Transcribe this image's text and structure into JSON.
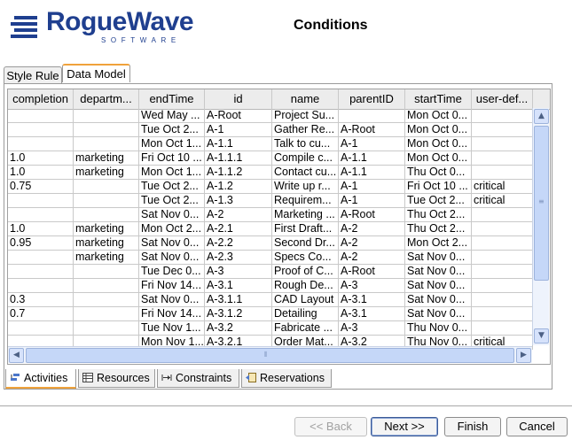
{
  "header": {
    "logo_text": "RogueWave",
    "logo_sub": "SOFTWARE",
    "title": "Conditions"
  },
  "top_tabs": [
    {
      "label": "Style Rule"
    },
    {
      "label": "Data Model"
    }
  ],
  "table": {
    "columns": [
      "completion",
      "departm...",
      "endTime",
      "id",
      "name",
      "parentID",
      "startTime",
      "user-def..."
    ],
    "rows": [
      [
        "",
        "",
        "Wed May ...",
        "A-Root",
        "Project Su...",
        "",
        "Mon Oct 0...",
        ""
      ],
      [
        "",
        "",
        "Tue Oct 2...",
        "A-1",
        "Gather Re...",
        "A-Root",
        "Mon Oct 0...",
        ""
      ],
      [
        "",
        "",
        "Mon Oct 1...",
        "A-1.1",
        "Talk to cu...",
        "A-1",
        "Mon Oct 0...",
        ""
      ],
      [
        "1.0",
        "marketing",
        "Fri Oct 10 ...",
        "A-1.1.1",
        "Compile c...",
        "A-1.1",
        "Mon Oct 0...",
        ""
      ],
      [
        "1.0",
        "marketing",
        "Mon Oct 1...",
        "A-1.1.2",
        "Contact cu...",
        "A-1.1",
        "Thu Oct 0...",
        ""
      ],
      [
        "0.75",
        "",
        "Tue Oct 2...",
        "A-1.2",
        "Write up r...",
        "A-1",
        "Fri Oct 10 ...",
        "critical"
      ],
      [
        "",
        "",
        "Tue Oct 2...",
        "A-1.3",
        "Requirem...",
        "A-1",
        "Tue Oct 2...",
        "critical"
      ],
      [
        "",
        "",
        "Sat Nov 0...",
        "A-2",
        "Marketing ...",
        "A-Root",
        "Thu Oct 2...",
        ""
      ],
      [
        "1.0",
        "marketing",
        "Mon Oct 2...",
        "A-2.1",
        "First Draft...",
        "A-2",
        "Thu Oct 2...",
        ""
      ],
      [
        "0.95",
        "marketing",
        "Sat Nov 0...",
        "A-2.2",
        "Second Dr...",
        "A-2",
        "Mon Oct 2...",
        ""
      ],
      [
        "",
        "marketing",
        "Sat Nov 0...",
        "A-2.3",
        "Specs Co...",
        "A-2",
        "Sat Nov 0...",
        ""
      ],
      [
        "",
        "",
        "Tue Dec 0...",
        "A-3",
        "Proof of C...",
        "A-Root",
        "Sat Nov 0...",
        ""
      ],
      [
        "",
        "",
        "Fri Nov 14...",
        "A-3.1",
        "Rough De...",
        "A-3",
        "Sat Nov 0...",
        ""
      ],
      [
        "0.3",
        "",
        "Sat Nov 0...",
        "A-3.1.1",
        "CAD Layout",
        "A-3.1",
        "Sat Nov 0...",
        ""
      ],
      [
        "0.7",
        "",
        "Fri Nov 14...",
        "A-3.1.2",
        "Detailing",
        "A-3.1",
        "Sat Nov 0...",
        ""
      ],
      [
        "",
        "",
        "Tue Nov 1...",
        "A-3.2",
        "Fabricate ...",
        "A-3",
        "Thu Nov 0...",
        ""
      ],
      [
        "",
        "",
        "Mon Nov 1...",
        "A-3.2.1",
        "Order Mat...",
        "A-3.2",
        "Thu Nov 0...",
        "critical"
      ]
    ]
  },
  "bottom_tabs": [
    {
      "label": "Activities",
      "icon": "activities-icon"
    },
    {
      "label": "Resources",
      "icon": "resources-icon"
    },
    {
      "label": "Constraints",
      "icon": "constraints-icon"
    },
    {
      "label": "Reservations",
      "icon": "reservations-icon"
    }
  ],
  "buttons": {
    "back": "<< Back",
    "next": "Next >>",
    "finish": "Finish",
    "cancel": "Cancel"
  },
  "colors": {
    "brand": "#1f3f8f",
    "tab_accent": "#f0a23b",
    "scrollbar": "#c5d7f8"
  }
}
